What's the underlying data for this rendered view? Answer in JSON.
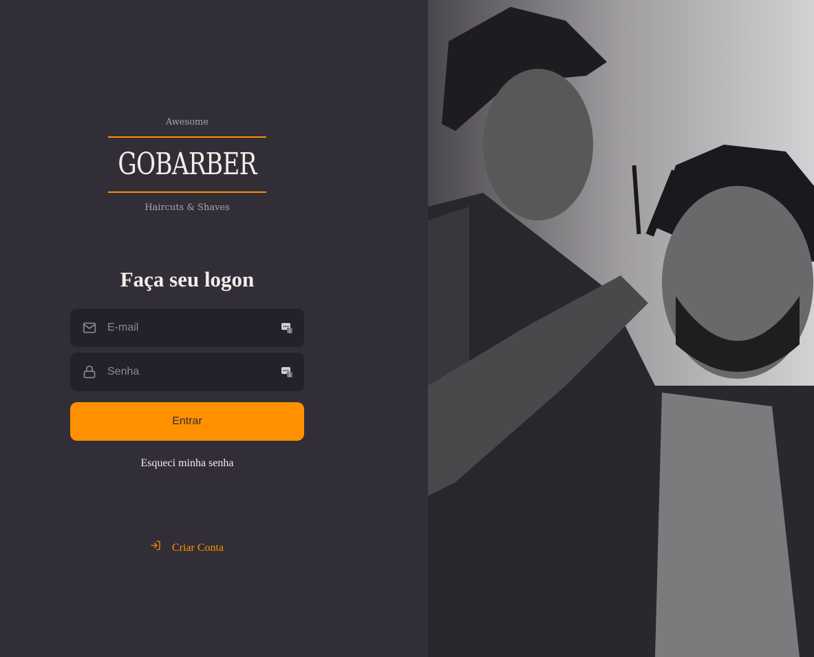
{
  "logo": {
    "top_text": "Awesome",
    "name": "GOBARBER",
    "bottom_text": "Haircuts & Shaves"
  },
  "form": {
    "title": "Faça seu logon",
    "email_placeholder": "E-mail",
    "password_placeholder": "Senha",
    "submit_label": "Entrar",
    "forgot_label": "Esqueci minha senha"
  },
  "footer": {
    "create_account_label": "Criar Conta"
  },
  "icons": {
    "email": "mail-icon",
    "password": "lock-icon",
    "autofill": "password-manager-icon",
    "create_account": "log-in-icon"
  },
  "colors": {
    "background": "#312e38",
    "input_background": "#232129",
    "accent": "#ff9000",
    "text": "#f4ede8",
    "placeholder": "#8e8b90"
  },
  "background_image": {
    "alt": ""
  }
}
